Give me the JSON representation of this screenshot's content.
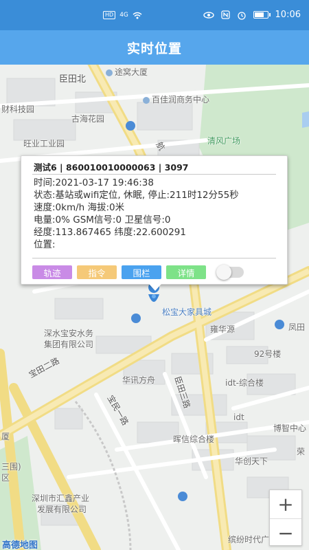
{
  "status_bar": {
    "hd": "HD",
    "signal": "4G",
    "time": "10:06",
    "battery_level": 0.85,
    "icons": [
      "hd-icon",
      "signal-icon",
      "wifi-icon",
      "eye-icon",
      "nfc-icon",
      "alarm-icon",
      "battery-icon"
    ]
  },
  "header": {
    "title": "实时位置"
  },
  "map": {
    "poi": [
      "臣田北",
      "途窝大厦",
      "百佳润商务中心",
      "财科技园",
      "古海花园",
      "旺业工业园",
      "清风广场",
      "松宝大家具城",
      "凤田",
      "雍华源",
      "深水宝安水务",
      "集团有限公司",
      "92号楼",
      "华讯方舟",
      "idt-综合楼",
      "idt",
      "博智中心",
      "荣",
      "晖信综合楼",
      "华创天下",
      "深圳市汇鑫产业",
      "发展有限公司",
      "缤纷时代广场",
      "厦",
      "三围)",
      "区"
    ],
    "roads": [
      "航",
      "宝田二路",
      "宝民一路",
      "臣田三路"
    ],
    "logo": "高德地图",
    "colors": {
      "water": "#a9cdf0",
      "road": "#f7e9a6",
      "green": "#c9e6c7",
      "block": "#e2e4e5"
    }
  },
  "popup": {
    "title": "测试6 | 860010010000063 | 3097",
    "lines": [
      "时间:2021-03-17 19:46:38",
      "状态:基站或wifi定位, 休眠, 停止:211时12分55秒",
      "速度:0km/h  海拔:0米",
      "电量:0%  GSM信号:0  卫星信号:0",
      "经度:113.867465    纬度:22.600291",
      "位置:"
    ],
    "buttons": [
      {
        "label": "轨迹",
        "color": "#c98be6"
      },
      {
        "label": "指令",
        "color": "#f5c978"
      },
      {
        "label": "围栏",
        "color": "#4aa2ef"
      },
      {
        "label": "详情",
        "color": "#7ee288"
      }
    ],
    "toggle_on": false
  },
  "zoom": {
    "in": "+",
    "out": "−"
  }
}
